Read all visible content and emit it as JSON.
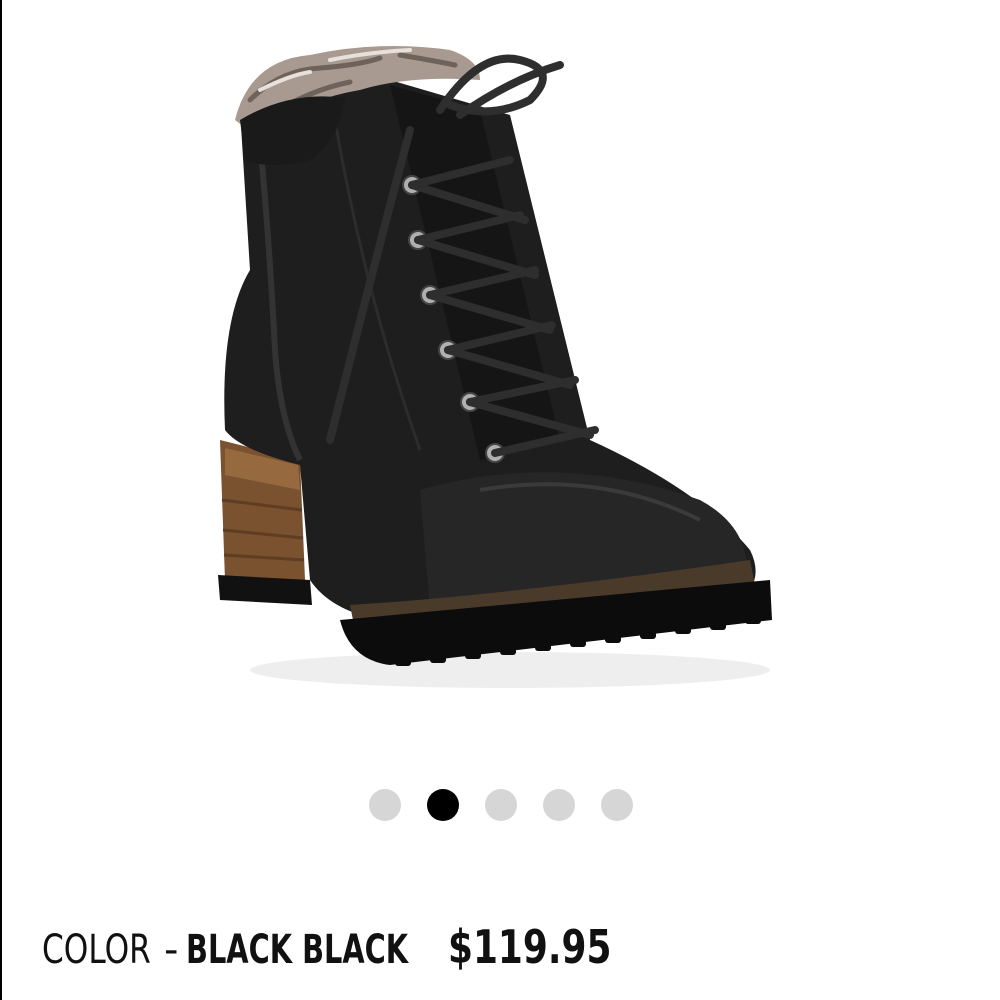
{
  "product": {
    "image_alt": "Black lace-up ankle boot with faux fur collar and stacked wood heel",
    "carousel": {
      "total": 5,
      "active_index": 1
    },
    "color_label": "COLOR",
    "color_separator": "-",
    "color_value": "BLACK BLACK",
    "price": "$119.95"
  },
  "colors": {
    "dot_inactive": "#d6d6d6",
    "dot_active": "#000000",
    "text": "#111111"
  }
}
